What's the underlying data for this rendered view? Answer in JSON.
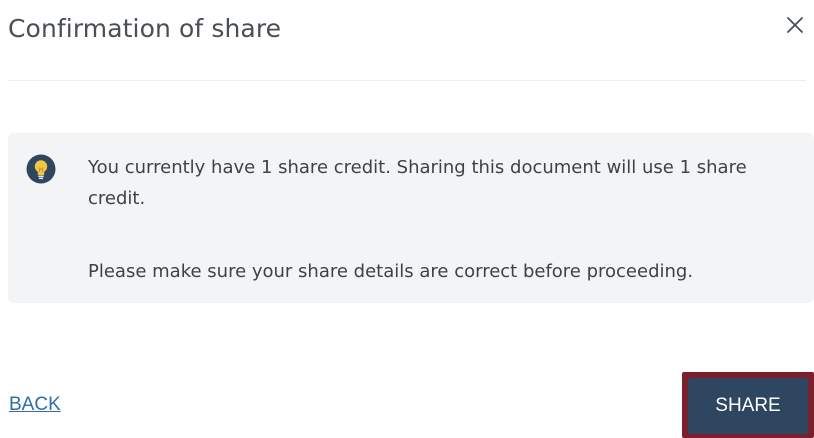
{
  "dialog": {
    "title": "Confirmation of share",
    "close_icon": "close-icon"
  },
  "info": {
    "icon": "lightbulb-icon",
    "message": "You currently have 1 share credit. Sharing this document will use 1 share credit.",
    "note": "Please make sure your share details are correct before proceeding."
  },
  "actions": {
    "back_label": "BACK",
    "share_label": "SHARE"
  },
  "colors": {
    "info_background": "#f3f4f5",
    "link": "#2f6fa9",
    "primary_button": "#2f4660",
    "highlight_border": "#7a1f2b",
    "icon_circle": "#2f4660",
    "icon_bulb": "#f4c542"
  }
}
